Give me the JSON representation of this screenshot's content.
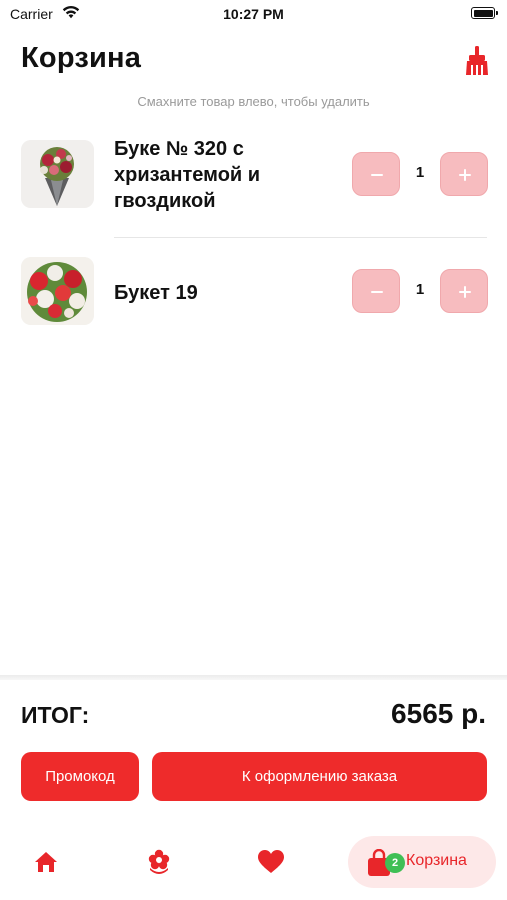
{
  "status_bar": {
    "carrier": "Carrier",
    "time": "10:27 PM"
  },
  "header": {
    "title": "Корзина",
    "clear_icon": "broom-icon"
  },
  "hint": "Смахните товар влево, чтобы удалить",
  "cart": {
    "items": [
      {
        "name": "Буке № 320 с хризантемой и гвоздикой",
        "quantity": "1"
      },
      {
        "name": "Букет 19",
        "quantity": "1"
      }
    ]
  },
  "summary": {
    "total_label": "ИТОГ:",
    "total_value": "6565 р."
  },
  "actions": {
    "promo_label": "Промокод",
    "checkout_label": "К оформлению заказа"
  },
  "tabbar": {
    "home_icon": "home-icon",
    "catalog_icon": "flower-icon",
    "favorites_icon": "heart-icon",
    "cart_badge": "2",
    "cart_label": "Корзина"
  },
  "colors": {
    "accent": "#ee2b2b",
    "qty_button": "#f7bcbf",
    "badge": "#3fbf55",
    "active_tab_bg": "#fde8e8"
  }
}
